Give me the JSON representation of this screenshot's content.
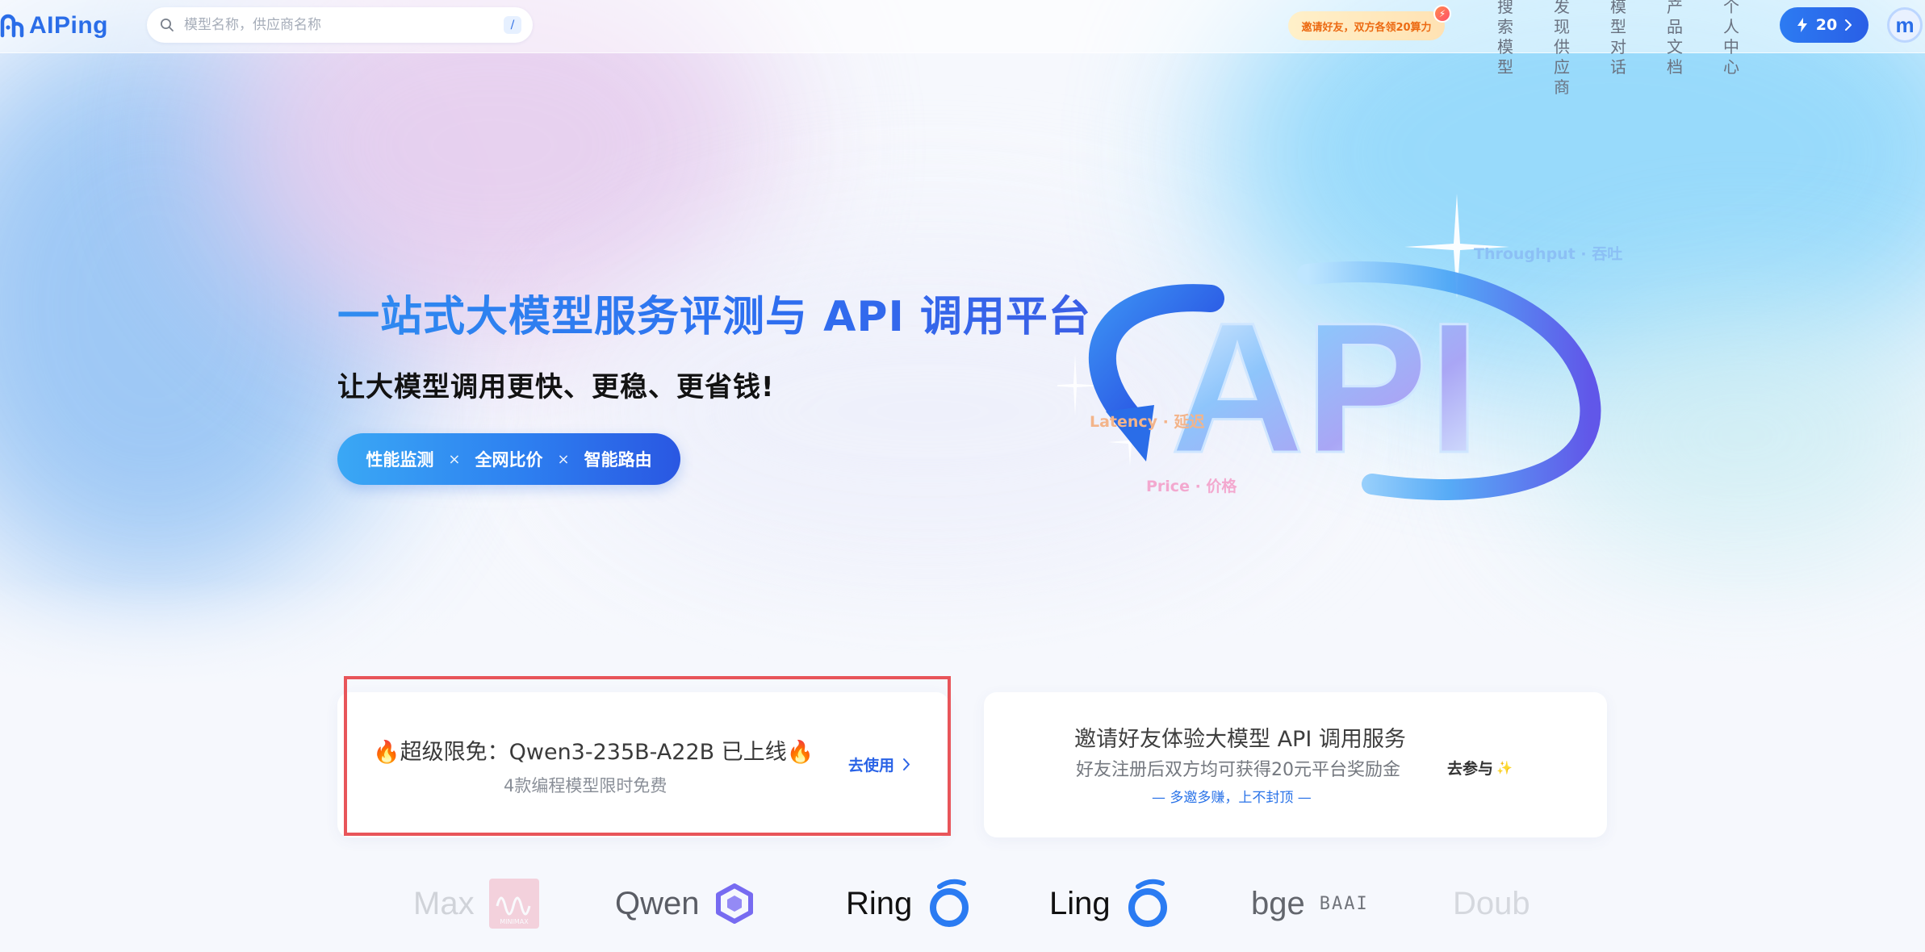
{
  "header": {
    "logo_text": "AIPing",
    "search": {
      "placeholder": "模型名称，供应商名称",
      "value": "",
      "shortcut_key": "/"
    },
    "invite_pill": "邀请好友，双方各领20算力",
    "nav": [
      "搜索模型",
      "发现供应商",
      "模型对话",
      "产品文档",
      "个人中心"
    ],
    "credits": "20",
    "avatar_letter": "m"
  },
  "hero": {
    "title": "一站式大模型服务评测与 API 调用平台",
    "subtitle": "让大模型调用更快、更稳、更省钱!",
    "features": [
      "性能监测",
      "全网比价",
      "智能路由"
    ],
    "feature_separator": "×",
    "graphic_text": "API",
    "metrics": {
      "throughput": "Throughput · 吞吐",
      "latency": "Latency · 延迟",
      "price": "Price · 价格"
    }
  },
  "promos": {
    "free": {
      "title": "🔥超级限免：Qwen3-235B-A22B 已上线🔥",
      "subtitle": "4款编程模型限时免费",
      "action": "去使用"
    },
    "invite": {
      "title": "邀请好友体验大模型 API 调用服务",
      "subtitle": "好友注册后双方均可获得20元平台奖励金",
      "tagline": "— 多邀多赚，上不封顶 —",
      "action": "去参与",
      "action_icon": "✨"
    }
  },
  "brands": [
    "Max",
    "Qwen",
    "Ring",
    "Ling",
    "bge",
    "Doub"
  ],
  "brand_badges": {
    "minimax": "MINIMAX",
    "baai": "BAAI"
  },
  "colors": {
    "primary": "#2a6de8",
    "highlight": "#e8555a"
  }
}
